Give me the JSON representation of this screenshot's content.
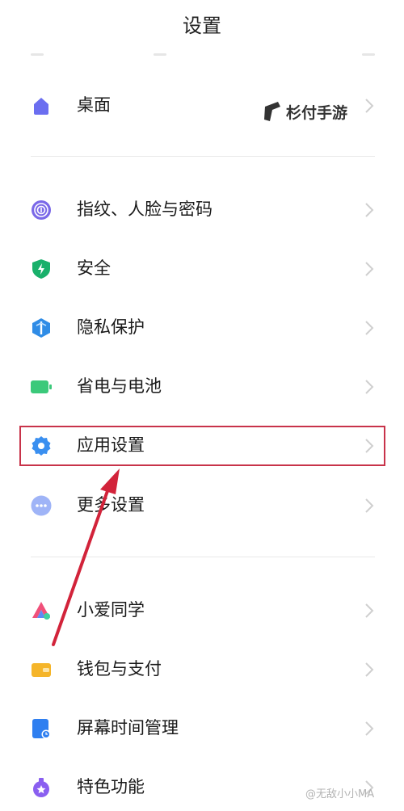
{
  "header": {
    "title": "设置"
  },
  "groups": [
    {
      "items": [
        {
          "label": "桌面",
          "icon": "home-icon",
          "color": "#6b6ef0"
        }
      ]
    },
    {
      "items": [
        {
          "label": "指纹、人脸与密码",
          "icon": "fingerprint-icon",
          "color": "#7a68e8"
        },
        {
          "label": "安全",
          "icon": "shield-icon",
          "color": "#19b06b"
        },
        {
          "label": "隐私保护",
          "icon": "privacy-icon",
          "color": "#2f8ce6"
        },
        {
          "label": "省电与电池",
          "icon": "battery-icon",
          "color": "#3bc97a"
        },
        {
          "label": "应用设置",
          "icon": "gear-icon",
          "color": "#3a8ff0"
        },
        {
          "label": "更多设置",
          "icon": "more-icon",
          "color": "#8aa6f5"
        }
      ]
    },
    {
      "items": [
        {
          "label": "小爱同学",
          "icon": "xiaoai-icon",
          "color": "#f0507a"
        },
        {
          "label": "钱包与支付",
          "icon": "wallet-icon",
          "color": "#f5b52a"
        },
        {
          "label": "屏幕时间管理",
          "icon": "screen-time-icon",
          "color": "#2f7ff0"
        },
        {
          "label": "特色功能",
          "icon": "special-features-icon",
          "color": "#8a5ff0"
        }
      ]
    }
  ],
  "annotation": {
    "highlight_color": "#c8334a",
    "arrow_color": "#d2233a"
  },
  "watermarks": {
    "top": "杉付手游",
    "bottom": "@无敌小小MA"
  }
}
